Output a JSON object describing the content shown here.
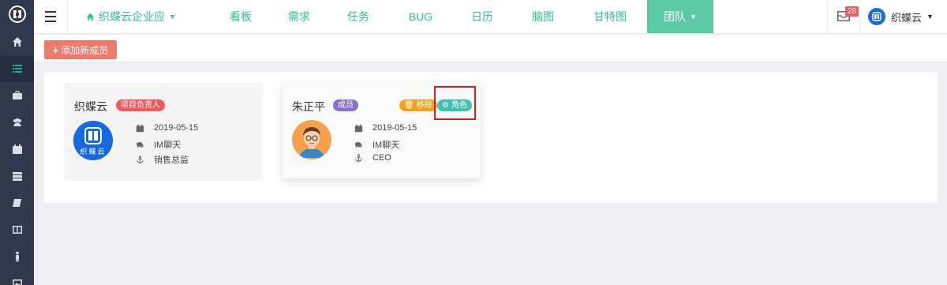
{
  "topnav": {
    "project_name": "织蝶云企业应",
    "tabs": [
      {
        "label": "看板"
      },
      {
        "label": "需求"
      },
      {
        "label": "任务"
      },
      {
        "label": "BUG"
      },
      {
        "label": "日历"
      },
      {
        "label": "脑图"
      },
      {
        "label": "甘特图"
      },
      {
        "label": "团队"
      }
    ],
    "active_tab": "团队",
    "mail_count": "28",
    "user_name": "织蝶云"
  },
  "sidebar": {
    "items": [
      {
        "icon": "home-icon"
      },
      {
        "icon": "list-icon"
      },
      {
        "icon": "briefcase-icon"
      },
      {
        "icon": "users-icon"
      },
      {
        "icon": "calendar-icon"
      },
      {
        "icon": "server-icon"
      },
      {
        "icon": "book-icon"
      },
      {
        "icon": "columns-icon"
      },
      {
        "icon": "person-icon"
      },
      {
        "icon": "image-icon"
      }
    ],
    "active_index": 1
  },
  "actions": {
    "add_member_label": "添加新成员"
  },
  "members": [
    {
      "name": "织蝶云",
      "role_tag": "项目负责人",
      "avatar_text": "织蝶云",
      "date": "2019-05-15",
      "chat": "IM聊天",
      "title": "销售总监"
    },
    {
      "name": "朱正平",
      "role_tag": "成员",
      "remove_label": "移除",
      "role_button_label": "角色",
      "date": "2019-05-15",
      "chat": "IM聊天",
      "title": "CEO"
    }
  ],
  "colors": {
    "sidebar_bg": "#2f3a4c",
    "accent_green": "#2ec28f",
    "active_tab_bg": "#5bc9a5",
    "add_button": "#ee7a6e",
    "tag_red": "#ee5b5b",
    "tag_purple": "#8a6fc9",
    "tag_orange": "#f3a21d",
    "tag_teal": "#3dc2b0",
    "highlight_red": "#e11b1b"
  }
}
